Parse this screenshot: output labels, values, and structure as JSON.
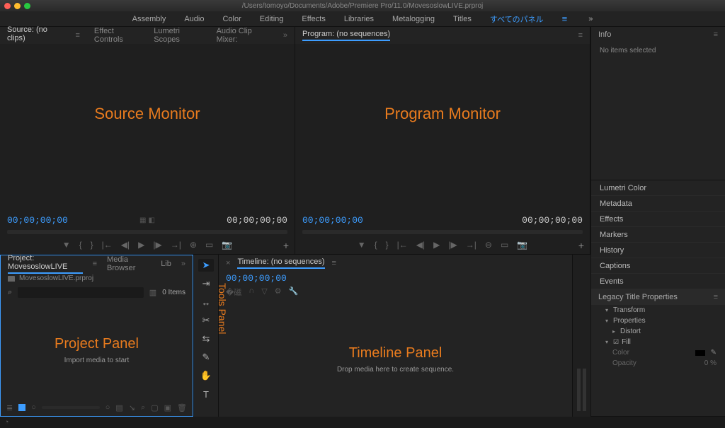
{
  "titlebar": {
    "path": "/Users/tomoyo/Documents/Adobe/Premiere Pro/11.0/MovesoslowLIVE.prproj"
  },
  "workspaces": {
    "items": [
      "Assembly",
      "Audio",
      "Color",
      "Editing",
      "Effects",
      "Libraries",
      "Metalogging",
      "Titles"
    ],
    "active": "すべてのパネル"
  },
  "source": {
    "tabs": [
      "Source: (no clips)",
      "Effect Controls",
      "Lumetri Scopes",
      "Audio Clip Mixer:"
    ],
    "label": "Source Monitor",
    "tc_left": "00;00;00;00",
    "tc_right": "00;00;00;00"
  },
  "program": {
    "tab": "Program: (no sequences)",
    "label": "Program Monitor",
    "tc_left": "00;00;00;00",
    "tc_right": "00;00;00;00"
  },
  "project": {
    "tabs": [
      "Project: MovesoslowLIVE",
      "Media Browser",
      "Lib"
    ],
    "file": "MovesoslowLIVE.prproj",
    "search_placeholder": "",
    "items_count": "0 Items",
    "label": "Project Panel",
    "hint": "Import media to start"
  },
  "tools": {
    "label": "Tools Panel",
    "items": [
      "selection",
      "track-select",
      "ripple",
      "razor",
      "slip",
      "pen",
      "hand",
      "type"
    ]
  },
  "timeline": {
    "tab": "Timeline: (no sequences)",
    "tc": "00;00;00;00",
    "label": "Timeline Panel",
    "hint": "Drop media here to create sequence."
  },
  "info": {
    "title": "Info",
    "body": "No items selected"
  },
  "side_panels": [
    "Lumetri Color",
    "Metadata",
    "Effects",
    "Markers",
    "History",
    "Captions",
    "Events"
  ],
  "legacy_title": {
    "header": "Legacy Title Properties",
    "rows": {
      "transform": "Transform",
      "properties": "Properties",
      "distort": "Distort",
      "fill": "Fill",
      "color": "Color",
      "opacity_label": "Opacity",
      "opacity_value": "0 %"
    }
  }
}
